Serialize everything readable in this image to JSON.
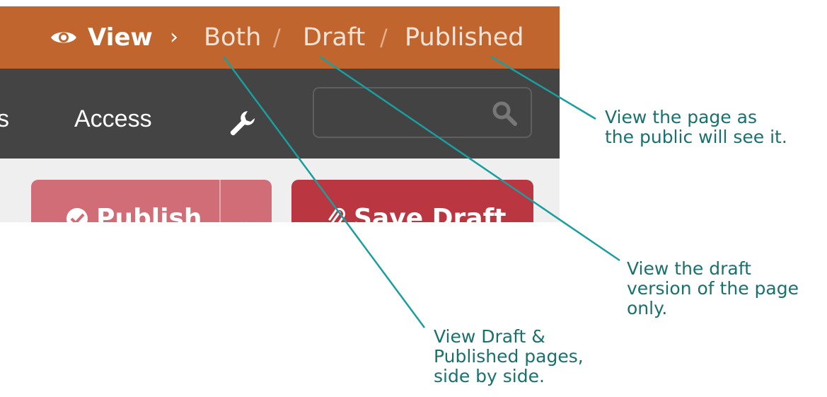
{
  "view_bar": {
    "view_label": "View",
    "separator_chevron": "›",
    "options": [
      "Both",
      "Draft",
      "Published"
    ],
    "option_separator": "/"
  },
  "nav": {
    "partial_item": "s",
    "access_label": "Access",
    "search": {
      "value": "",
      "placeholder": ""
    }
  },
  "actions": {
    "publish_label": "Publish",
    "save_draft_label": "Save Draft"
  },
  "annotations": {
    "published": [
      "View the page as",
      "the public will see it."
    ],
    "draft": [
      "View the draft",
      "version of the page",
      "only."
    ],
    "both": [
      "View Draft &",
      "Published pages,",
      "side by side."
    ]
  },
  "colors": {
    "view_bar": "#c1652e",
    "navbar": "#444444",
    "publish_button": "#d16d76",
    "save_button": "#ba3640",
    "annotation": "#19716e"
  }
}
